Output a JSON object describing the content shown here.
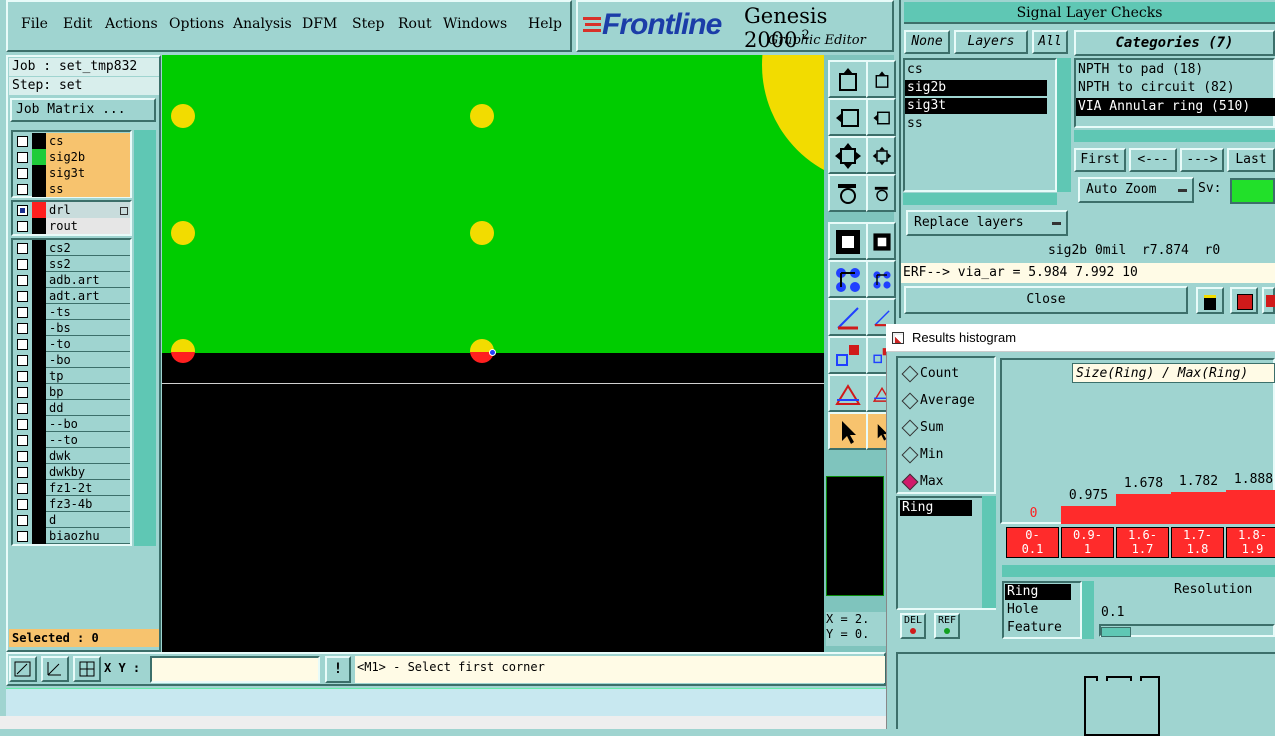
{
  "menu": [
    "File",
    "Edit",
    "Actions",
    "Options",
    "Analysis",
    "DFM",
    "Step",
    "Rout",
    "Windows",
    "Help"
  ],
  "logo": {
    "brand": "Frontline",
    "product": "Genesis 2000",
    "product_suffix": "2",
    "subtitle": "Graphic Editor"
  },
  "job": {
    "job_label": "Job : set_tmp832",
    "step_label": "Step: set",
    "matrix_button": "Job Matrix ..."
  },
  "layers_top": [
    {
      "name": "cs",
      "swatch": "#000000",
      "bg": "#f7c36e"
    },
    {
      "name": "sig2b",
      "swatch": "#1fcc3a",
      "bg": "#f7c36e"
    },
    {
      "name": "sig3t",
      "swatch": "#000000",
      "bg": "#f7c36e"
    },
    {
      "name": "ss",
      "swatch": "#000000",
      "bg": "#f7c36e"
    }
  ],
  "layers_drill": [
    {
      "name": "drl",
      "swatch": "#ff1f1f",
      "bg": "#c8dcdc"
    },
    {
      "name": "rout",
      "swatch": "#000000",
      "bg": "#e6e6e6"
    }
  ],
  "layers_misc": [
    "cs2",
    "ss2",
    "adb.art",
    "adt.art",
    "-ts",
    "-bs",
    "-to",
    "-bo",
    "tp",
    "bp",
    "dd",
    "--bo",
    "--to",
    "dwk",
    "dwkby",
    "fz1-2t",
    "fz3-4b",
    "d",
    "biaozhu"
  ],
  "selected": "Selected : 0",
  "coords": {
    "x": "X = 2.",
    "y": "Y = 0."
  },
  "bottom_bar": {
    "xy_label": "X Y :",
    "xy_value": "",
    "bang": "!",
    "prompt": "<M1> - Select first corner"
  },
  "signal_panel": {
    "title": "Signal Layer Checks",
    "btn_none": "None",
    "btn_layers": "Layers",
    "btn_all": "All",
    "layers": [
      "cs",
      "sig2b",
      "sig3t",
      "ss"
    ],
    "selected_layers": [
      "sig2b",
      "sig3t"
    ],
    "categories_title": "Categories (7)",
    "categories": [
      "NPTH to pad (18)",
      "NPTH to circuit (82)",
      "VIA Annular ring (510)"
    ],
    "nav": [
      "First",
      "<---",
      "--->",
      "Last"
    ],
    "auto_zoom": "Auto Zoom",
    "sv_label": "Sv:",
    "replace_layers": "Replace layers",
    "status": "sig2b 0mil  r7.874  r0",
    "erf": "ERF--> via_ar = 5.984 7.992 10",
    "close": "Close"
  },
  "histogram": {
    "title": "Results histogram",
    "options": [
      "Count",
      "Average",
      "Sum",
      "Min",
      "Max"
    ],
    "selected_option": "Max",
    "list_item": "Ring",
    "del": "DEL",
    "ref": "REF",
    "header": "Size(Ring) / Max(Ring)",
    "bins": [
      {
        "value": "0",
        "range": [
          "0-",
          "0.1"
        ]
      },
      {
        "value": "0.975",
        "range": [
          "0.9-",
          "1"
        ]
      },
      {
        "value": "1.678",
        "range": [
          "1.6-",
          "1.7"
        ]
      },
      {
        "value": "1.782",
        "range": [
          "1.7-",
          "1.8"
        ]
      },
      {
        "value": "1.888",
        "range": [
          "1.8-",
          "1.9"
        ]
      }
    ],
    "modes": [
      "Ring",
      "Hole",
      "Feature"
    ],
    "selected_mode": "Ring",
    "resolution_label": "Resolution",
    "resolution_value": "0.1"
  },
  "colors": {
    "panel": "#9fd4d0",
    "panel_dark": "#5fc7b4",
    "canvas_green": "#00cc00",
    "pad_yellow": "#f2dc00",
    "drill_red": "#ff1f1f",
    "layer_orange": "#f7c36e",
    "hist_red": "#ff2b2b"
  }
}
